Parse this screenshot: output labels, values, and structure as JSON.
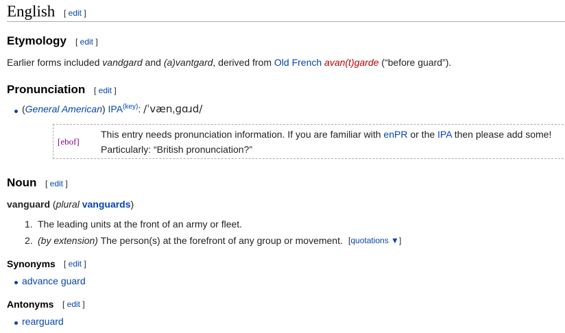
{
  "edit_label": "edit",
  "english": {
    "title": "English"
  },
  "etymology": {
    "title": "Etymology",
    "pre": "Earlier forms included ",
    "form1": "vandgard",
    "and": " and ",
    "form2": "(a)vantgard",
    "derived": ", derived from ",
    "source_lang": "Old French",
    "source_word": "avan(t)garde",
    "gloss": " (“before guard”)."
  },
  "pronunciation": {
    "title": "Pronunciation",
    "open_paren": "(",
    "accent": "General American",
    "close_paren": ")",
    "ipa_label": "IPA",
    "key_label": "(key)",
    "colon": ":",
    "ipa_value": "/ˈvænˌɡɑɹd/",
    "notice_tag": "[ebof]",
    "notice_line1_pre": "This entry needs pronunciation information. If you are familiar with ",
    "notice_enpr": "enPR",
    "notice_or": " or the ",
    "notice_ipa": "IPA",
    "notice_line1_post": " then please add some!",
    "notice_line2": "Particularly: “British pronunciation?”"
  },
  "noun": {
    "title": "Noun",
    "headword": "vanguard",
    "plural_open": " (",
    "plural_label": "plural",
    "plural_form": "vanguards",
    "plural_close": ")",
    "senses": [
      {
        "num": "1.",
        "text": "The leading units at the front of an army or fleet."
      },
      {
        "num": "2.",
        "qualifier": "(by extension)",
        "text": " The person(s) at the forefront of any group or movement."
      }
    ],
    "quotations_label": "quotations ▼",
    "quot_open": "[",
    "quot_close": "]"
  },
  "synonyms": {
    "title": "Synonyms",
    "items": [
      "advance guard"
    ]
  },
  "antonyms": {
    "title": "Antonyms",
    "items": [
      "rearguard"
    ]
  },
  "colors": {
    "link": "#0645ad",
    "redlink": "#ba0000",
    "heading_rule": "#aaaaaa",
    "ebof": "#8b008b"
  }
}
